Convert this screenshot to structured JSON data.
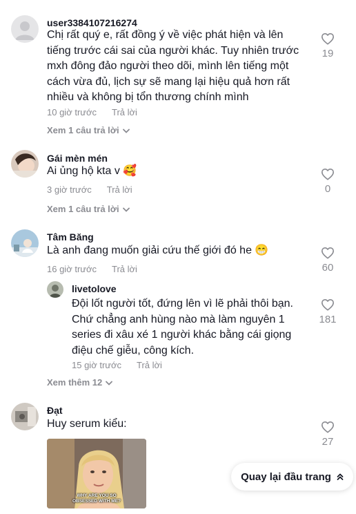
{
  "comments": [
    {
      "username": "user3384107216274",
      "lines": [
        "Chị rất quý e, rất đồng ý về việc phát hiện và lên",
        "tiếng trước cái sai của người khác. Tuy nhiên trước",
        "mxh đông đảo người theo dõi, mình lên tiếng một",
        "cách vừa đủ, lịch sự sẽ mang lại hiệu quả hơn rất",
        "nhiều và không bị tổn thương chính mình"
      ],
      "time": "10 giờ trước",
      "reply_label": "Trả lời",
      "likes": "19",
      "view_replies": "Xem 1 câu trả lời"
    },
    {
      "username": "Gái mèn mén",
      "text": "Ai ủng hộ kta v 🥰",
      "time": "3 giờ trước",
      "reply_label": "Trả lời",
      "likes": "0",
      "view_replies": "Xem 1 câu trả lời"
    },
    {
      "username": "Tâm Băng",
      "text": "Là anh đang muốn giải cứu thế giới đó he 😁",
      "time": "16 giờ trước",
      "reply_label": "Trả lời",
      "likes": "60",
      "reply": {
        "username": "livetolove",
        "lines": [
          "Đội lốt người tốt, đứng lên vì lẽ phải thôi bạn.",
          "Chứ chẳng anh hùng nào mà làm nguyên 1",
          "series đi xâu xé 1 người khác bằng cái giọng",
          "điệu chế giễu, công kích."
        ],
        "time": "15 giờ trước",
        "reply_label": "Trả lời",
        "likes": "181"
      },
      "view_more": "Xem thêm 12"
    },
    {
      "username": "Đạt",
      "text": "Huy serum kiểu:",
      "likes": "27",
      "gif_caption": [
        "WHY ARE YOU SO",
        "OBSESSED WITH ME?"
      ]
    }
  ],
  "back_to_top": "Quay lại đầu trang",
  "colors": {
    "text": "#161823",
    "secondary": "#8a8b91",
    "background": "#ffffff"
  },
  "icons": [
    "heart-outline-icon",
    "chevron-down-icon",
    "double-chevron-up-icon"
  ]
}
